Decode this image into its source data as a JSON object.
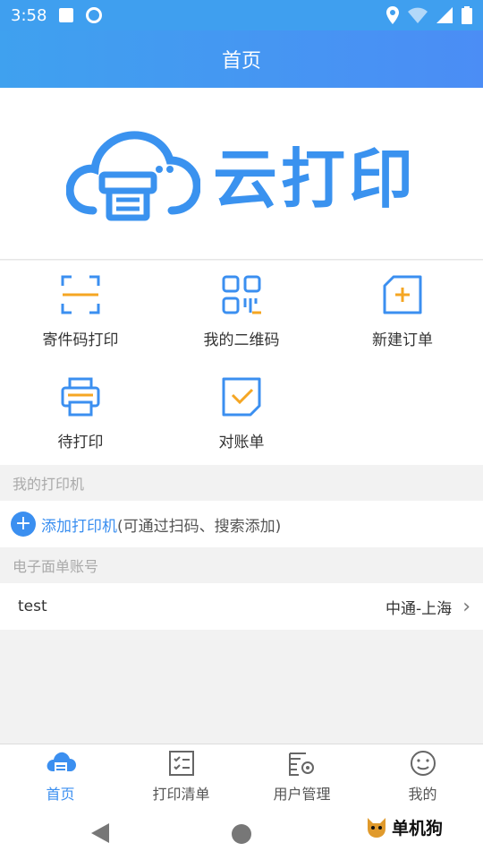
{
  "status": {
    "time": "3:58"
  },
  "appbar": {
    "title": "首页"
  },
  "banner": {
    "logo_text": "云打印"
  },
  "grid": {
    "items": [
      {
        "label": "寄件码打印",
        "icon": "scan-icon"
      },
      {
        "label": "我的二维码",
        "icon": "qrcode-icon"
      },
      {
        "label": "新建订单",
        "icon": "new-order-icon"
      },
      {
        "label": "待打印",
        "icon": "printer-icon"
      },
      {
        "label": "对账单",
        "icon": "statement-icon"
      }
    ]
  },
  "printers": {
    "header": "我的打印机",
    "add_main": "添加打印机",
    "add_hint": "(可通过扫码、搜索添加)"
  },
  "accounts": {
    "header": "电子面单账号",
    "rows": [
      {
        "name": "test",
        "carrier": "中通-上海"
      }
    ]
  },
  "tabs": [
    {
      "label": "首页",
      "icon": "cloud-printer-icon",
      "active": true
    },
    {
      "label": "打印清单",
      "icon": "checklist-icon",
      "active": false
    },
    {
      "label": "用户管理",
      "icon": "user-settings-icon",
      "active": false
    },
    {
      "label": "我的",
      "icon": "smiley-icon",
      "active": false
    }
  ],
  "watermark": {
    "text": "单机狗"
  },
  "colors": {
    "accent": "#3b8ff0",
    "icon_orange": "#f5a623"
  }
}
